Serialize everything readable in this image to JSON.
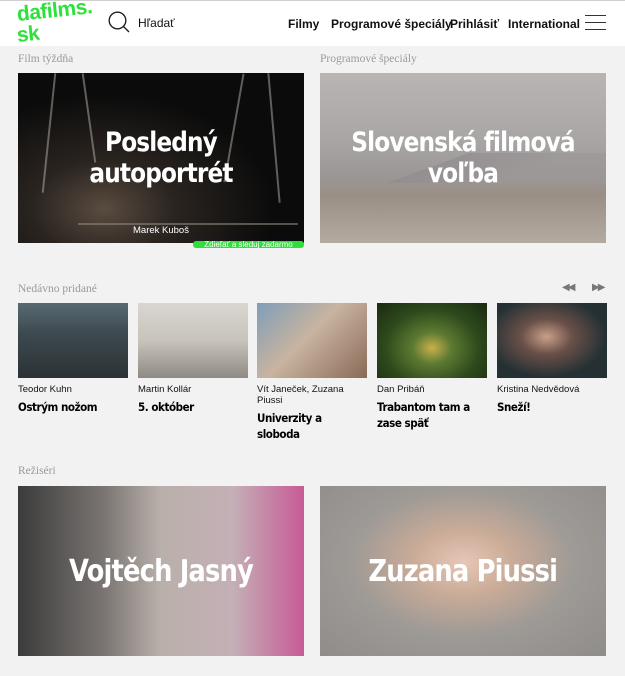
{
  "header": {
    "logo_line1": "dafilms.",
    "logo_line2": "sk",
    "search_label": "Hľadať",
    "nav": {
      "films": "Filmy",
      "specials": "Programové špeciály",
      "login": "Prihlásiť",
      "international": "International"
    },
    "logo_color": "#2ee03a"
  },
  "film_of_week": {
    "section_label": "Film týždňa",
    "title": "Posledný autoportrét",
    "author": "Marek Kuboš",
    "badge": "Zdieľať a sleduj zadarmo"
  },
  "program_special": {
    "section_label": "Programové špeciály",
    "title": "Slovenská filmová voľba"
  },
  "recent": {
    "section_label": "Nedávno pridané",
    "prev_arrow": "◀◀",
    "next_arrow": "▶▶",
    "films": [
      {
        "director": "Teodor Kuhn",
        "title": "Ostrým nožom"
      },
      {
        "director": "Martin Kollár",
        "title": "5. október"
      },
      {
        "director": "Vít Janeček, Zuzana Piussi",
        "title": "Univerzity a sloboda"
      },
      {
        "director": "Dan Pribáň",
        "title": "Trabantom tam a zase späť"
      },
      {
        "director": "Kristina Nedvědová",
        "title": "Sneží!"
      }
    ]
  },
  "directors": {
    "section_label": "Režiséri",
    "items": [
      {
        "name": "Vojtěch Jasný"
      },
      {
        "name": "Zuzana Piussi"
      }
    ]
  }
}
